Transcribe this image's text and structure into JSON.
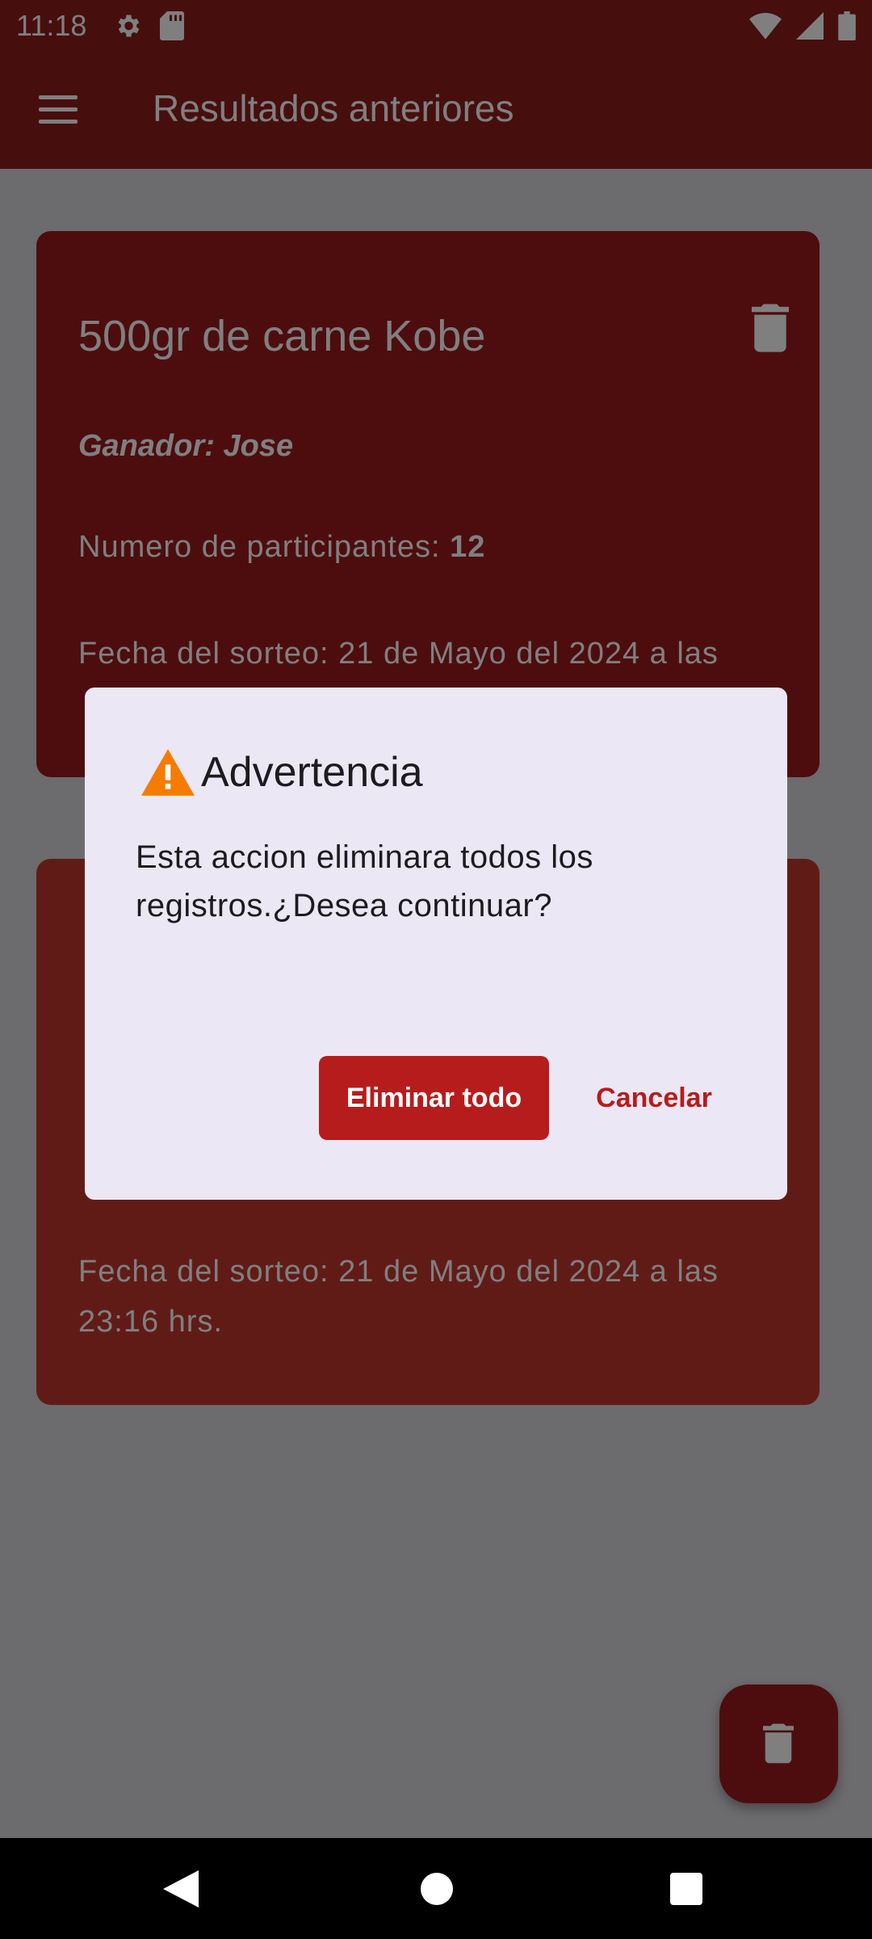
{
  "status_bar": {
    "time": "11:18",
    "icons": [
      "gear-icon",
      "sd-card-icon",
      "wifi-icon",
      "signal-icon",
      "battery-icon"
    ]
  },
  "app_bar": {
    "title": "Resultados anteriores",
    "menu_icon": "menu-icon"
  },
  "cards": [
    {
      "title": "500gr de carne Kobe",
      "winner": "Ganador: Jose",
      "participants_label": "Numero de participantes: ",
      "participants_value": "12",
      "date": "Fecha del sorteo: 21 de Mayo del 2024 a las"
    },
    {
      "date": "Fecha del sorteo: 21 de Mayo del 2024 a las 23:16 hrs."
    }
  ],
  "dialog": {
    "title": "Advertencia",
    "message": "Esta accion eliminara todos los registros.¿Desea continuar?",
    "confirm_label": "Eliminar todo",
    "cancel_label": "Cancelar"
  },
  "colors": {
    "primary": "#8e1c1c",
    "accent": "#b71c1c",
    "dialog_bg": "#ece7f4",
    "warning": "#f57c00"
  }
}
